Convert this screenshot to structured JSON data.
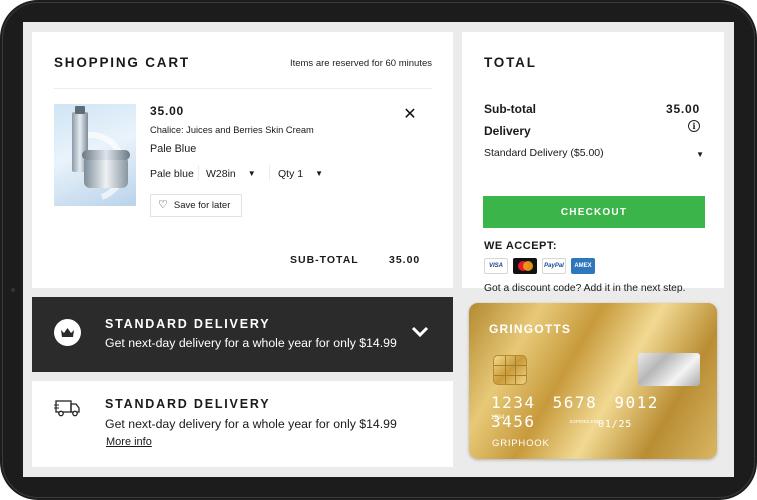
{
  "cart": {
    "title": "SHOPPING CART",
    "reserve_note": "Items are reserved for 60 minutes",
    "item": {
      "price": "35.00",
      "name": "Chalice: Juices and Berries Skin Cream",
      "color": "Pale Blue",
      "color_option": "Pale blue",
      "size_option": "W28in",
      "qty_option": "Qty 1",
      "save_label": "Save for later"
    },
    "subtotal_label": "SUB-TOTAL",
    "subtotal_value": "35.00"
  },
  "total": {
    "title": "TOTAL",
    "subtotal_label": "Sub-total",
    "subtotal_value": "35.00",
    "delivery_label": "Delivery",
    "delivery_option": "Standard Delivery ($5.00)",
    "checkout_label": "CHECKOUT",
    "accept_label": "WE ACCEPT:",
    "payment_methods": [
      "VISA",
      "MasterCard",
      "PayPal",
      "AMEX"
    ],
    "payment_labels": {
      "visa": "VISA",
      "paypal": "PayPal",
      "amex": "AMEX"
    },
    "discount_note": "Got a discount code? Add it in the next step."
  },
  "promo_dark": {
    "title": "STANDARD DELIVERY",
    "text": "Get next-day delivery for a whole year for only $14.99"
  },
  "promo_light": {
    "title": "STANDARD DELIVERY",
    "text": "Get next-day delivery for a whole year for only $14.99",
    "link": "More info"
  },
  "card": {
    "bank": "GRINGOTTS",
    "number": "1234 5678 9012 3456",
    "sub_number": "1234",
    "expires_label": "EXPIRES END",
    "expiry": "01/25",
    "holder": "GRIPHOOK"
  },
  "colors": {
    "checkout_green": "#3bb54a",
    "dark_panel": "#2b2b2b",
    "screen_bg": "#ebebeb",
    "card_gold": "#d9b765"
  }
}
